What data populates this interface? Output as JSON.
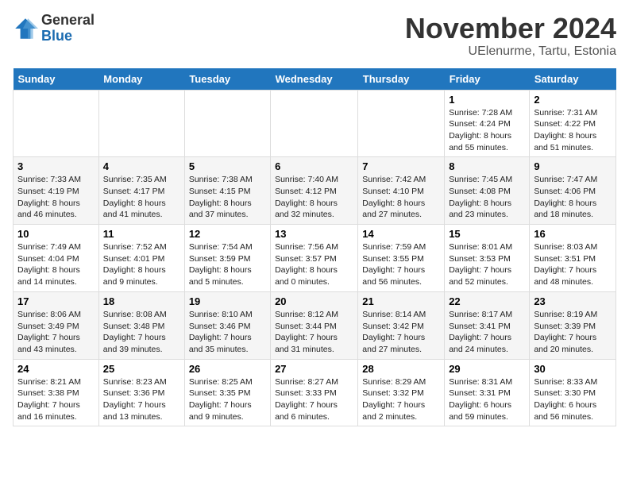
{
  "logo": {
    "general": "General",
    "blue": "Blue"
  },
  "title": "November 2024",
  "subtitle": "UElenurme, Tartu, Estonia",
  "days_of_week": [
    "Sunday",
    "Monday",
    "Tuesday",
    "Wednesday",
    "Thursday",
    "Friday",
    "Saturday"
  ],
  "weeks": [
    [
      {
        "day": "",
        "info": ""
      },
      {
        "day": "",
        "info": ""
      },
      {
        "day": "",
        "info": ""
      },
      {
        "day": "",
        "info": ""
      },
      {
        "day": "",
        "info": ""
      },
      {
        "day": "1",
        "info": "Sunrise: 7:28 AM\nSunset: 4:24 PM\nDaylight: 8 hours and 55 minutes."
      },
      {
        "day": "2",
        "info": "Sunrise: 7:31 AM\nSunset: 4:22 PM\nDaylight: 8 hours and 51 minutes."
      }
    ],
    [
      {
        "day": "3",
        "info": "Sunrise: 7:33 AM\nSunset: 4:19 PM\nDaylight: 8 hours and 46 minutes."
      },
      {
        "day": "4",
        "info": "Sunrise: 7:35 AM\nSunset: 4:17 PM\nDaylight: 8 hours and 41 minutes."
      },
      {
        "day": "5",
        "info": "Sunrise: 7:38 AM\nSunset: 4:15 PM\nDaylight: 8 hours and 37 minutes."
      },
      {
        "day": "6",
        "info": "Sunrise: 7:40 AM\nSunset: 4:12 PM\nDaylight: 8 hours and 32 minutes."
      },
      {
        "day": "7",
        "info": "Sunrise: 7:42 AM\nSunset: 4:10 PM\nDaylight: 8 hours and 27 minutes."
      },
      {
        "day": "8",
        "info": "Sunrise: 7:45 AM\nSunset: 4:08 PM\nDaylight: 8 hours and 23 minutes."
      },
      {
        "day": "9",
        "info": "Sunrise: 7:47 AM\nSunset: 4:06 PM\nDaylight: 8 hours and 18 minutes."
      }
    ],
    [
      {
        "day": "10",
        "info": "Sunrise: 7:49 AM\nSunset: 4:04 PM\nDaylight: 8 hours and 14 minutes."
      },
      {
        "day": "11",
        "info": "Sunrise: 7:52 AM\nSunset: 4:01 PM\nDaylight: 8 hours and 9 minutes."
      },
      {
        "day": "12",
        "info": "Sunrise: 7:54 AM\nSunset: 3:59 PM\nDaylight: 8 hours and 5 minutes."
      },
      {
        "day": "13",
        "info": "Sunrise: 7:56 AM\nSunset: 3:57 PM\nDaylight: 8 hours and 0 minutes."
      },
      {
        "day": "14",
        "info": "Sunrise: 7:59 AM\nSunset: 3:55 PM\nDaylight: 7 hours and 56 minutes."
      },
      {
        "day": "15",
        "info": "Sunrise: 8:01 AM\nSunset: 3:53 PM\nDaylight: 7 hours and 52 minutes."
      },
      {
        "day": "16",
        "info": "Sunrise: 8:03 AM\nSunset: 3:51 PM\nDaylight: 7 hours and 48 minutes."
      }
    ],
    [
      {
        "day": "17",
        "info": "Sunrise: 8:06 AM\nSunset: 3:49 PM\nDaylight: 7 hours and 43 minutes."
      },
      {
        "day": "18",
        "info": "Sunrise: 8:08 AM\nSunset: 3:48 PM\nDaylight: 7 hours and 39 minutes."
      },
      {
        "day": "19",
        "info": "Sunrise: 8:10 AM\nSunset: 3:46 PM\nDaylight: 7 hours and 35 minutes."
      },
      {
        "day": "20",
        "info": "Sunrise: 8:12 AM\nSunset: 3:44 PM\nDaylight: 7 hours and 31 minutes."
      },
      {
        "day": "21",
        "info": "Sunrise: 8:14 AM\nSunset: 3:42 PM\nDaylight: 7 hours and 27 minutes."
      },
      {
        "day": "22",
        "info": "Sunrise: 8:17 AM\nSunset: 3:41 PM\nDaylight: 7 hours and 24 minutes."
      },
      {
        "day": "23",
        "info": "Sunrise: 8:19 AM\nSunset: 3:39 PM\nDaylight: 7 hours and 20 minutes."
      }
    ],
    [
      {
        "day": "24",
        "info": "Sunrise: 8:21 AM\nSunset: 3:38 PM\nDaylight: 7 hours and 16 minutes."
      },
      {
        "day": "25",
        "info": "Sunrise: 8:23 AM\nSunset: 3:36 PM\nDaylight: 7 hours and 13 minutes."
      },
      {
        "day": "26",
        "info": "Sunrise: 8:25 AM\nSunset: 3:35 PM\nDaylight: 7 hours and 9 minutes."
      },
      {
        "day": "27",
        "info": "Sunrise: 8:27 AM\nSunset: 3:33 PM\nDaylight: 7 hours and 6 minutes."
      },
      {
        "day": "28",
        "info": "Sunrise: 8:29 AM\nSunset: 3:32 PM\nDaylight: 7 hours and 2 minutes."
      },
      {
        "day": "29",
        "info": "Sunrise: 8:31 AM\nSunset: 3:31 PM\nDaylight: 6 hours and 59 minutes."
      },
      {
        "day": "30",
        "info": "Sunrise: 8:33 AM\nSunset: 3:30 PM\nDaylight: 6 hours and 56 minutes."
      }
    ]
  ]
}
